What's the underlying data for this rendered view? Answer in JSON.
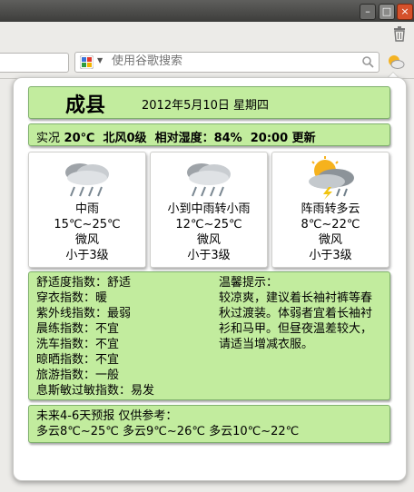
{
  "window": {
    "minimize": "–",
    "maximize": "□",
    "close": "×"
  },
  "search": {
    "placeholder": "使用谷歌搜索"
  },
  "weather": {
    "city": "成县",
    "date": "2012年5月10日  星期四",
    "now": {
      "label": "实况",
      "temp": "20℃",
      "wind": "北风0级",
      "humidity": "相对湿度：84%",
      "update": "20:00 更新"
    },
    "days": [
      {
        "icon": "cloud-rain-icon",
        "condition": "中雨",
        "temp": "15℃~25℃",
        "wind": "微风",
        "level": "小于3级"
      },
      {
        "icon": "cloud-rain-icon",
        "condition": "小到中雨转小雨",
        "temp": "12℃~25℃",
        "wind": "微风",
        "level": "小于3级"
      },
      {
        "icon": "thunderstorm-sun-icon",
        "condition": "阵雨转多云",
        "temp": "8℃~22℃",
        "wind": "微风",
        "level": "小于3级"
      }
    ],
    "indices": [
      "舒适度指数：舒适",
      "穿衣指数：暖",
      "紫外线指数：最弱",
      "晨练指数：不宜",
      "洗车指数：不宜",
      "晾晒指数：不宜",
      "旅游指数：一般",
      "息斯敏过敏指数：易发"
    ],
    "tips_title": "温馨提示：",
    "tips": "较凉爽，建议着长袖衬裤等春秋过渡装。体弱者宜着长袖衬衫和马甲。但昼夜温差较大，请适当增减衣服。",
    "forecast_title": "未来4-6天预报 仅供参考：",
    "forecast": "多云8℃~25℃ 多云9℃~26℃ 多云10℃~22℃"
  }
}
